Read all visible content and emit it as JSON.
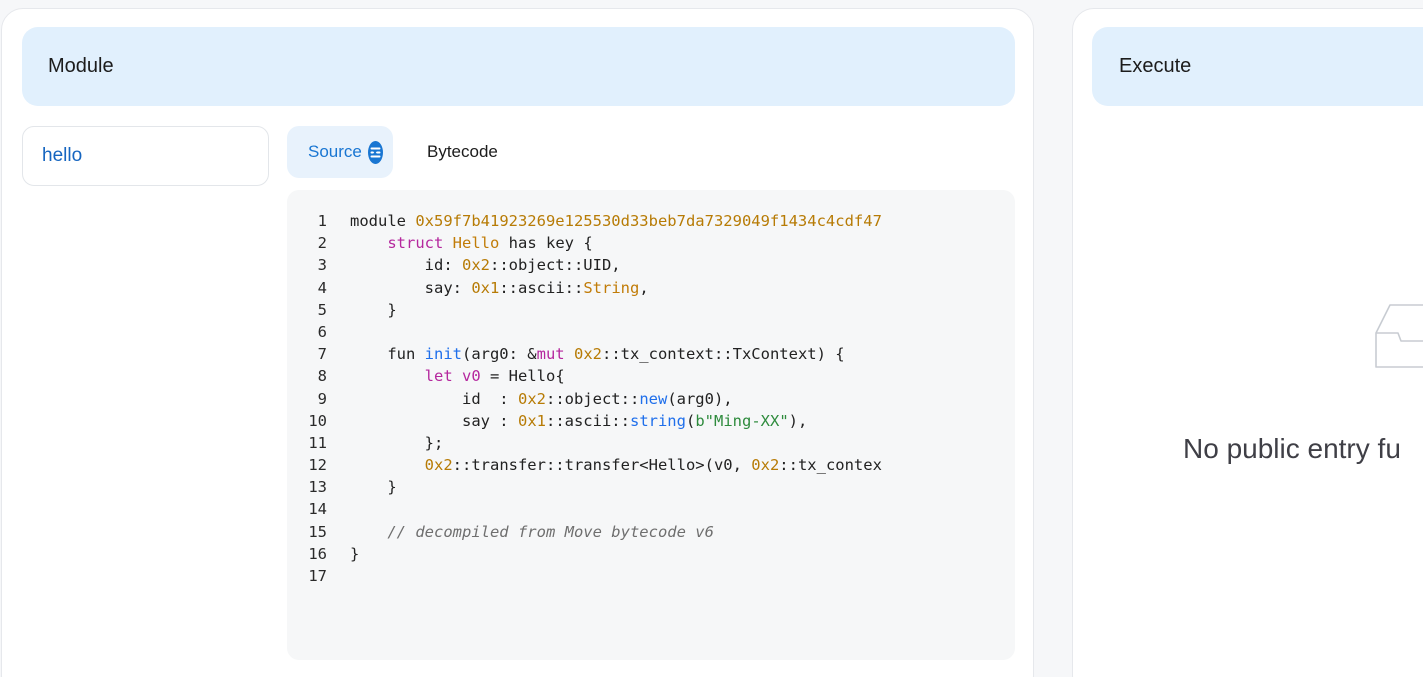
{
  "module_panel": {
    "title": "Module",
    "modules": [
      {
        "name": "hello"
      }
    ],
    "tabs": [
      {
        "label": "Source",
        "active": true,
        "icon": "verified-badge-icon"
      },
      {
        "label": "Bytecode",
        "active": false
      }
    ],
    "source_lines": [
      {
        "n": "1",
        "tokens": [
          {
            "t": "module "
          },
          {
            "t": "0x59f7b41923269e125530d33beb7da7329049f1434c4cdf47",
            "c": "t-addr"
          }
        ]
      },
      {
        "n": "2",
        "tokens": [
          {
            "t": "    "
          },
          {
            "t": "struct",
            "c": "t-kw"
          },
          {
            "t": " "
          },
          {
            "t": "Hello",
            "c": "t-type"
          },
          {
            "t": " has key {"
          }
        ]
      },
      {
        "n": "3",
        "tokens": [
          {
            "t": "        id: "
          },
          {
            "t": "0x2",
            "c": "t-addr"
          },
          {
            "t": "::object::UID,"
          }
        ]
      },
      {
        "n": "4",
        "tokens": [
          {
            "t": "        say: "
          },
          {
            "t": "0x1",
            "c": "t-addr"
          },
          {
            "t": "::ascii::"
          },
          {
            "t": "String",
            "c": "t-type"
          },
          {
            "t": ","
          }
        ]
      },
      {
        "n": "5",
        "tokens": [
          {
            "t": "    }"
          }
        ]
      },
      {
        "n": "6",
        "tokens": [
          {
            "t": ""
          }
        ]
      },
      {
        "n": "7",
        "tokens": [
          {
            "t": "    fun "
          },
          {
            "t": "init",
            "c": "t-fn"
          },
          {
            "t": "(arg0: &"
          },
          {
            "t": "mut",
            "c": "t-kw"
          },
          {
            "t": " "
          },
          {
            "t": "0x2",
            "c": "t-addr"
          },
          {
            "t": "::tx_context::TxContext) {"
          }
        ]
      },
      {
        "n": "8",
        "tokens": [
          {
            "t": "        "
          },
          {
            "t": "let",
            "c": "t-kw"
          },
          {
            "t": " "
          },
          {
            "t": "v0",
            "c": "t-kw"
          },
          {
            "t": " = Hello{"
          }
        ]
      },
      {
        "n": "9",
        "tokens": [
          {
            "t": "            id  : "
          },
          {
            "t": "0x2",
            "c": "t-addr"
          },
          {
            "t": "::object::"
          },
          {
            "t": "new",
            "c": "t-fn"
          },
          {
            "t": "(arg0),"
          }
        ]
      },
      {
        "n": "10",
        "tokens": [
          {
            "t": "            say : "
          },
          {
            "t": "0x1",
            "c": "t-addr"
          },
          {
            "t": "::ascii::"
          },
          {
            "t": "string",
            "c": "t-fn"
          },
          {
            "t": "("
          },
          {
            "t": "b\"Ming-XX\"",
            "c": "t-str"
          },
          {
            "t": "),"
          }
        ]
      },
      {
        "n": "11",
        "tokens": [
          {
            "t": "        };"
          }
        ]
      },
      {
        "n": "12",
        "tokens": [
          {
            "t": "        "
          },
          {
            "t": "0x2",
            "c": "t-addr"
          },
          {
            "t": "::transfer::transfer<Hello>(v0, "
          },
          {
            "t": "0x2",
            "c": "t-addr"
          },
          {
            "t": "::tx_contex"
          }
        ]
      },
      {
        "n": "13",
        "tokens": [
          {
            "t": "    }"
          }
        ]
      },
      {
        "n": "14",
        "tokens": [
          {
            "t": ""
          }
        ]
      },
      {
        "n": "15",
        "tokens": [
          {
            "t": "    "
          },
          {
            "t": "// decompiled from Move bytecode v6",
            "c": "t-cmt"
          }
        ]
      },
      {
        "n": "16",
        "tokens": [
          {
            "t": "}"
          }
        ]
      },
      {
        "n": "17",
        "tokens": [
          {
            "t": ""
          }
        ]
      }
    ]
  },
  "execute_panel": {
    "title": "Execute",
    "empty_icon": "empty-inbox-icon",
    "empty_text": "No public entry fu"
  },
  "colors": {
    "header_bg": "#e1f0fd",
    "accent": "#1976d2",
    "code_bg": "#f6f7f8",
    "address": "#b77b05",
    "keyword": "#b5289e",
    "function": "#1f6feb",
    "string": "#2e8b3d"
  }
}
